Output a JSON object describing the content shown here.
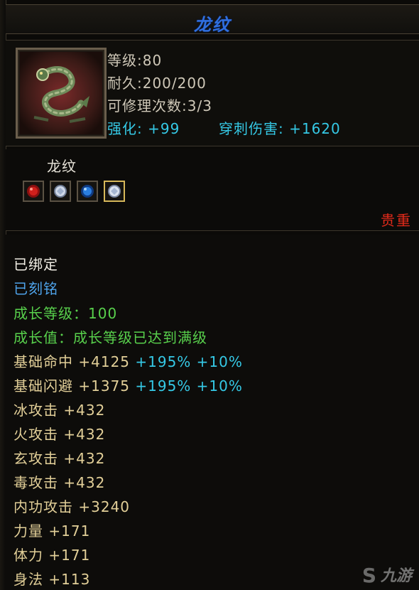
{
  "title": "龙纹",
  "stats": {
    "level": "等级:80",
    "durability": "耐久:200/200",
    "repair": "可修理次数:3/3",
    "enhance": "强化: +99",
    "pierce": "穿刺伤害: +1620"
  },
  "sub_name": "龙纹",
  "gems": [
    {
      "name": "red-orb-icon",
      "color": "#d0201c"
    },
    {
      "name": "white-crystal-icon",
      "color": "#cfd8e8"
    },
    {
      "name": "blue-orb-icon",
      "color": "#2a7ee0"
    },
    {
      "name": "white-crystal-icon",
      "color": "#dbe2ef"
    }
  ],
  "rarity": "贵重",
  "attributes": {
    "bound": "已绑定",
    "engraved": "已刻铭",
    "growth_level": "成长等级：100",
    "growth_value": "成长值：成长等级已达到满级",
    "hit_label": "基础命中 +4125",
    "hit_pct1": "+195%",
    "hit_pct2": "+10%",
    "dodge_label": "基础闪避 +1375",
    "dodge_pct1": "+195%",
    "dodge_pct2": "+10%",
    "ice": "冰攻击 +432",
    "fire": "火攻击 +432",
    "mystic": "玄攻击 +432",
    "poison": "毒攻击 +432",
    "inner": "内功攻击 +3240",
    "strength": "力量 +171",
    "stamina": "体力 +171",
    "agility": "身法 +113"
  },
  "watermark": "九游",
  "colors": {
    "title": "#2f6fe0",
    "cyan": "#35c9e6",
    "green": "#58d04c",
    "tan": "#e2cf98",
    "rarity": "#e22a1a"
  }
}
